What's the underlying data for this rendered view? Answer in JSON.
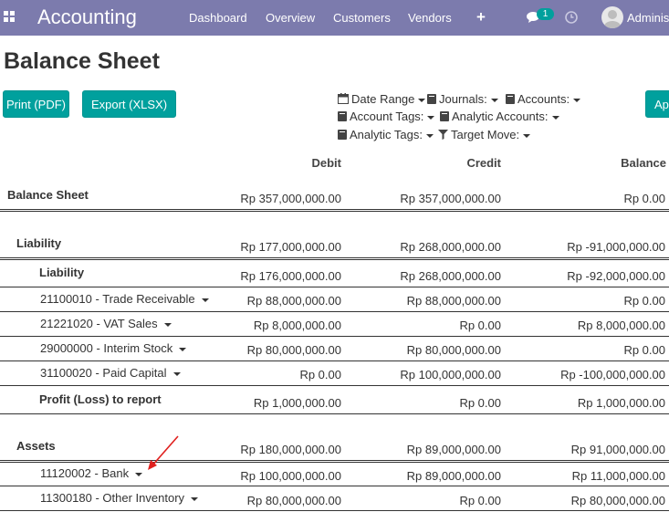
{
  "navbar": {
    "brand": "Accounting",
    "menu": [
      "Dashboard",
      "Overview",
      "Customers",
      "Vendors"
    ],
    "chat_count": "1",
    "user": "Adminis",
    "icons": [
      "apps-grid-icon",
      "plus-icon",
      "chat-icon",
      "clock-icon",
      "avatar"
    ]
  },
  "page": {
    "title": "Balance Sheet",
    "print_label": "Print (PDF)",
    "export_label": "Export (XLSX)",
    "apply_label": "Ap"
  },
  "filters": {
    "date_range": "Date Range",
    "journals": "Journals:",
    "accounts": "Accounts:",
    "account_tags": "Account Tags:",
    "analytic_accounts": "Analytic Accounts:",
    "analytic_tags": "Analytic Tags:",
    "target_move": "Target Move:"
  },
  "table": {
    "headers": {
      "debit": "Debit",
      "credit": "Credit",
      "balance": "Balance"
    },
    "rows": [
      {
        "label": "Balance Sheet",
        "debit": "Rp 357,000,000.00",
        "credit": "Rp 357,000,000.00",
        "balance": "Rp 0.00"
      },
      {
        "label": "Liability",
        "debit": "Rp 177,000,000.00",
        "credit": "Rp 268,000,000.00",
        "balance": "Rp -91,000,000.00"
      },
      {
        "label": "Liability",
        "debit": "Rp 176,000,000.00",
        "credit": "Rp 268,000,000.00",
        "balance": "Rp -92,000,000.00"
      },
      {
        "label": "21100010 - Trade Receivable",
        "debit": "Rp 88,000,000.00",
        "credit": "Rp 88,000,000.00",
        "balance": "Rp 0.00"
      },
      {
        "label": "21221020 - VAT Sales",
        "debit": "Rp 8,000,000.00",
        "credit": "Rp 0.00",
        "balance": "Rp 8,000,000.00"
      },
      {
        "label": "29000000 - Interim Stock",
        "debit": "Rp 80,000,000.00",
        "credit": "Rp 80,000,000.00",
        "balance": "Rp 0.00"
      },
      {
        "label": "31100020 - Paid Capital",
        "debit": "Rp 0.00",
        "credit": "Rp 100,000,000.00",
        "balance": "Rp -100,000,000.00"
      },
      {
        "label": "Profit (Loss) to report",
        "debit": "Rp 1,000,000.00",
        "credit": "Rp 0.00",
        "balance": "Rp 1,000,000.00"
      },
      {
        "label": "Assets",
        "debit": "Rp 180,000,000.00",
        "credit": "Rp 89,000,000.00",
        "balance": "Rp 91,000,000.00"
      },
      {
        "label": "11120002 - Bank",
        "debit": "Rp 100,000,000.00",
        "credit": "Rp 89,000,000.00",
        "balance": "Rp 11,000,000.00"
      },
      {
        "label": "11300180 - Other Inventory",
        "debit": "Rp 80,000,000.00",
        "credit": "Rp 0.00",
        "balance": "Rp 80,000,000.00"
      }
    ]
  },
  "colors": {
    "navbar": "#7c7bad",
    "button": "#00a09d",
    "annotation_arrow": "#e0201e"
  }
}
